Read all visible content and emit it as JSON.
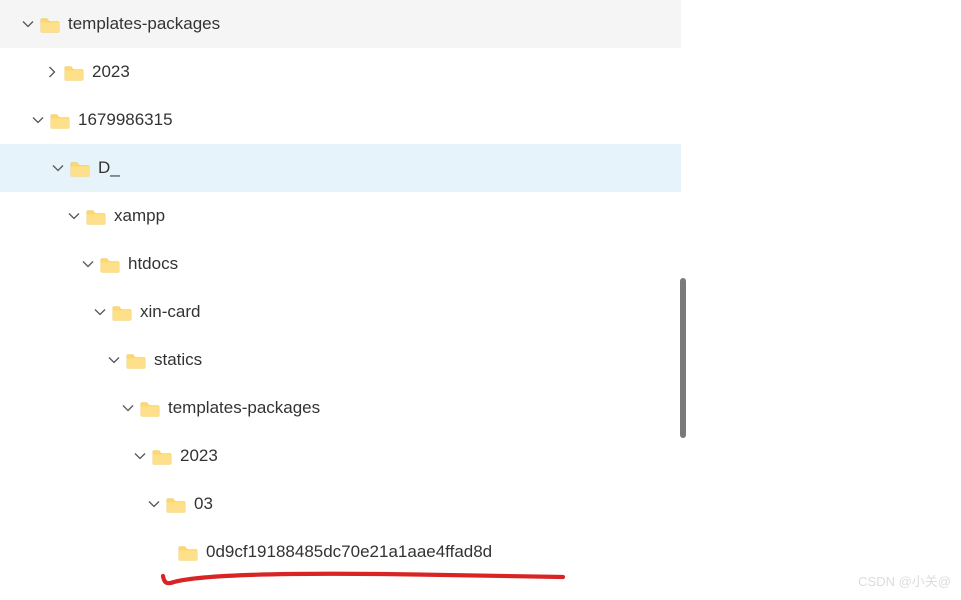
{
  "tree": [
    {
      "indent": 20,
      "expand": "open",
      "name": "templates-packages",
      "selected": false
    },
    {
      "indent": 44,
      "expand": "closed",
      "name": "2023",
      "selected": false
    },
    {
      "indent": 30,
      "expand": "open",
      "name": "1679986315",
      "selected": false
    },
    {
      "indent": 50,
      "expand": "open",
      "name": "D_",
      "selected": true
    },
    {
      "indent": 66,
      "expand": "open",
      "name": "xampp",
      "selected": false
    },
    {
      "indent": 80,
      "expand": "open",
      "name": "htdocs",
      "selected": false
    },
    {
      "indent": 92,
      "expand": "open",
      "name": "xin-card",
      "selected": false
    },
    {
      "indent": 106,
      "expand": "open",
      "name": "statics",
      "selected": false
    },
    {
      "indent": 120,
      "expand": "open",
      "name": "templates-packages",
      "selected": false
    },
    {
      "indent": 132,
      "expand": "open",
      "name": "2023",
      "selected": false
    },
    {
      "indent": 146,
      "expand": "open",
      "name": "03",
      "selected": false
    },
    {
      "indent": 158,
      "expand": "none",
      "name": "0d9cf19188485dc70e21a1aae4ffad8d",
      "selected": false
    }
  ],
  "watermark": "CSDN @小关@"
}
